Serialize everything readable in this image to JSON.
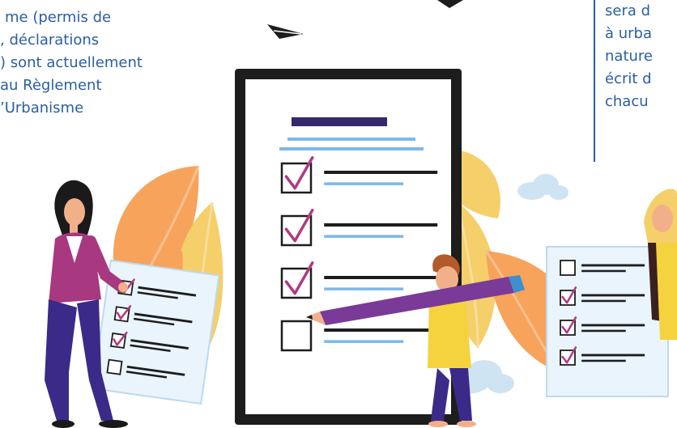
{
  "text_left": {
    "lines": [
      "me (permis de",
      ", déclarations",
      ") sont actuellement",
      "au Règlement",
      "’Urbanisme"
    ]
  },
  "text_right": {
    "lines": [
      "sera d",
      "à urba",
      "nature",
      "écrit d",
      "chacu"
    ]
  },
  "colors": {
    "text_blue": "#2a5ea3",
    "checkmark": "#b03a82",
    "pencil": "#7a3a97",
    "leaf_orange": "#f7a35c",
    "leaf_yellow": "#f4cf6a",
    "cloud": "#cfe4f3",
    "board_frame": "#1d1d1d"
  },
  "clipboard": {
    "items_checked": [
      true,
      true,
      true,
      false
    ]
  },
  "left_sheet": {
    "items_checked": [
      true,
      true,
      true,
      false
    ]
  },
  "right_sheet": {
    "items_checked": [
      false,
      true,
      true,
      true
    ]
  }
}
